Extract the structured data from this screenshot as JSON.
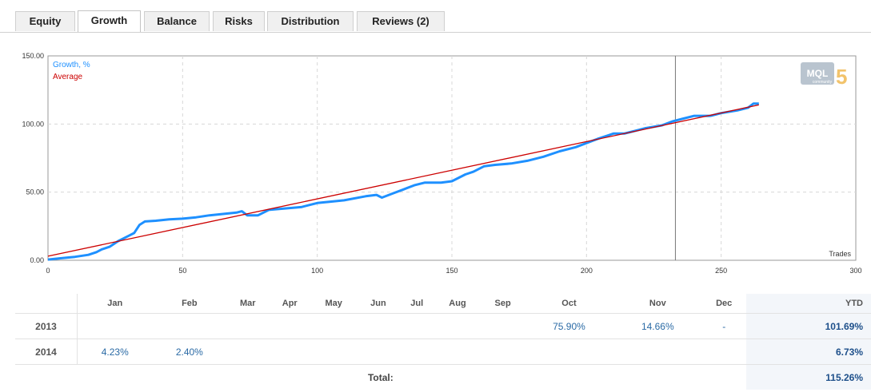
{
  "tabs": [
    {
      "label": "Equity",
      "active": false
    },
    {
      "label": "Growth",
      "active": true
    },
    {
      "label": "Balance",
      "active": false
    },
    {
      "label": "Risks",
      "active": false
    },
    {
      "label": "Distribution",
      "active": false
    },
    {
      "label": "Reviews (2)",
      "active": false
    }
  ],
  "logo": {
    "text": "MQL",
    "digit": "5",
    "sub": "community"
  },
  "chart_data": {
    "type": "line",
    "x_label": "Trades",
    "xlim": [
      0,
      300
    ],
    "ylim": [
      0,
      150
    ],
    "x_ticks": [
      "0",
      "50",
      "100",
      "150",
      "200",
      "250",
      "300"
    ],
    "y_ticks": [
      "0.00",
      "50.00",
      "100.00",
      "150.00"
    ],
    "grid": true,
    "legend_position": "top-left",
    "marker_x": 233,
    "series": [
      {
        "name": "Growth, %",
        "color": "#1e90ff",
        "points": [
          [
            0,
            0.5
          ],
          [
            5,
            1.5
          ],
          [
            10,
            2.5
          ],
          [
            15,
            4
          ],
          [
            18,
            6
          ],
          [
            20,
            8
          ],
          [
            23,
            10
          ],
          [
            26,
            14
          ],
          [
            28,
            16
          ],
          [
            30,
            18
          ],
          [
            32,
            20
          ],
          [
            34,
            26
          ],
          [
            36,
            28.5
          ],
          [
            40,
            29
          ],
          [
            45,
            30
          ],
          [
            50,
            30.5
          ],
          [
            55,
            31.5
          ],
          [
            60,
            33
          ],
          [
            65,
            34
          ],
          [
            70,
            35
          ],
          [
            72,
            36
          ],
          [
            74,
            33
          ],
          [
            78,
            33
          ],
          [
            82,
            37
          ],
          [
            88,
            38
          ],
          [
            94,
            39
          ],
          [
            100,
            42
          ],
          [
            110,
            44
          ],
          [
            118,
            47
          ],
          [
            122,
            48
          ],
          [
            124,
            46
          ],
          [
            128,
            49
          ],
          [
            132,
            52
          ],
          [
            136,
            55
          ],
          [
            140,
            57
          ],
          [
            146,
            57
          ],
          [
            150,
            58
          ],
          [
            155,
            63
          ],
          [
            158,
            65
          ],
          [
            162,
            69
          ],
          [
            166,
            70
          ],
          [
            172,
            71
          ],
          [
            178,
            73
          ],
          [
            184,
            76
          ],
          [
            190,
            80
          ],
          [
            196,
            83
          ],
          [
            200,
            86
          ],
          [
            204,
            89
          ],
          [
            210,
            93
          ],
          [
            214,
            93
          ],
          [
            218,
            95
          ],
          [
            222,
            97
          ],
          [
            228,
            99
          ],
          [
            232,
            102
          ],
          [
            236,
            104
          ],
          [
            240,
            106
          ],
          [
            246,
            106
          ],
          [
            250,
            108
          ],
          [
            256,
            110
          ],
          [
            260,
            112
          ],
          [
            262,
            115
          ],
          [
            264,
            115
          ]
        ]
      },
      {
        "name": "Average",
        "color": "#cc0000",
        "points": [
          [
            0,
            3
          ],
          [
            264,
            114
          ]
        ]
      }
    ]
  },
  "table": {
    "months": [
      "Jan",
      "Feb",
      "Mar",
      "Apr",
      "May",
      "Jun",
      "Jul",
      "Aug",
      "Sep",
      "Oct",
      "Nov",
      "Dec"
    ],
    "ytd_label": "YTD",
    "rows": [
      {
        "year": "2013",
        "values": [
          "",
          "",
          "",
          "",
          "",
          "",
          "",
          "",
          "",
          "75.90%",
          "14.66%",
          "-"
        ],
        "ytd": "101.69%"
      },
      {
        "year": "2014",
        "values": [
          "4.23%",
          "2.40%",
          "",
          "",
          "",
          "",
          "",
          "",
          "",
          "",
          "",
          ""
        ],
        "ytd": "6.73%"
      }
    ],
    "total_label": "Total:",
    "total_value": "115.26%"
  }
}
